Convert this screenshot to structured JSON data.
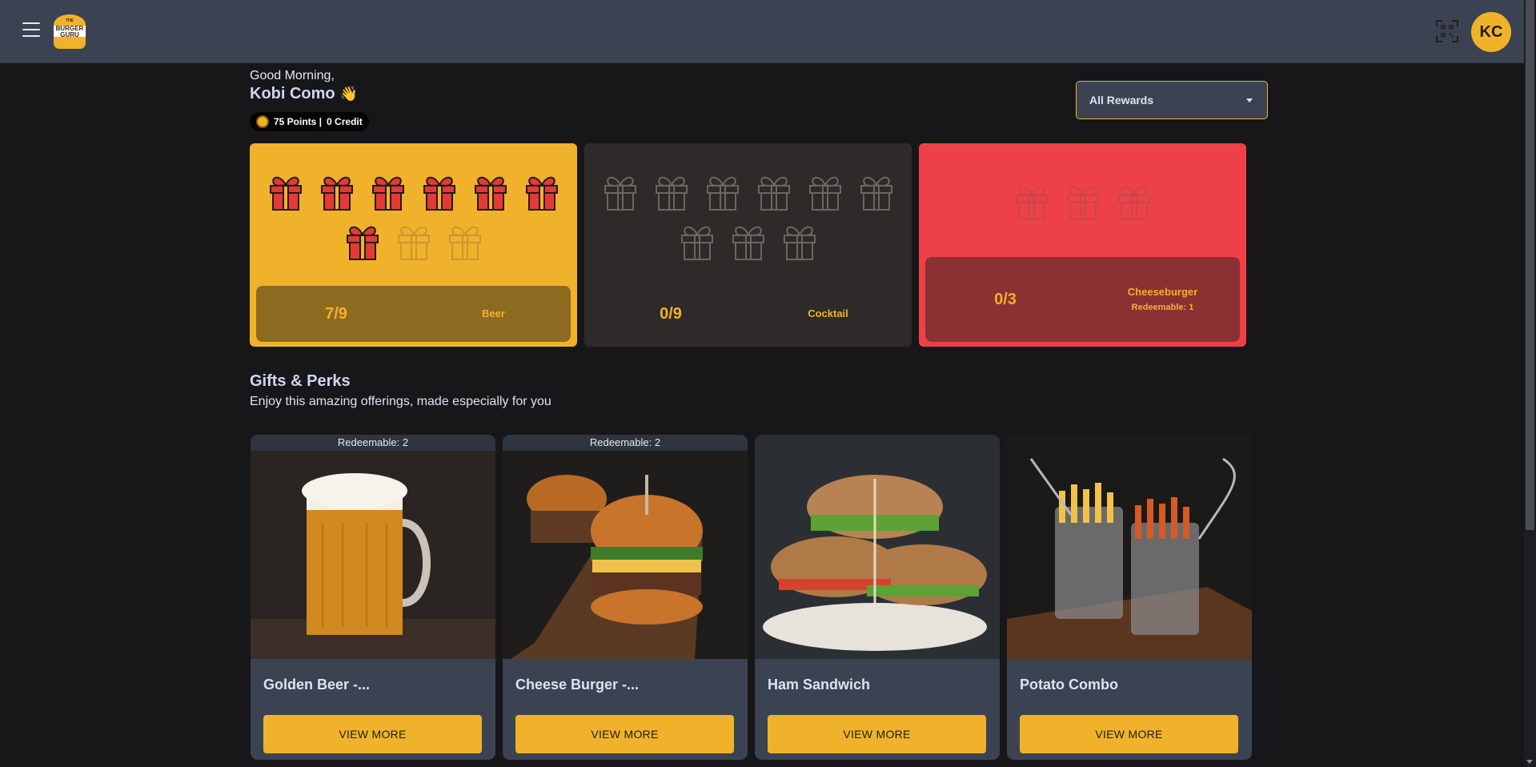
{
  "header": {
    "menu_icon": "hamburger-menu-icon",
    "logo_text_top": "THE",
    "logo_text_mid": "BURGER",
    "logo_text_bot": "GURU",
    "qr_icon": "qr-code-icon",
    "avatar_initials": "KC"
  },
  "user": {
    "greeting": "Good Morning,",
    "name": "Kobi Como",
    "wave": "👋",
    "points": "75 Points |",
    "credit": "0 Credit"
  },
  "filter": {
    "selected": "All Rewards"
  },
  "reward_cards": [
    {
      "count": "7/9",
      "name": "Beer",
      "redeemable": "",
      "total": 9,
      "earned": 7
    },
    {
      "count": "0/9",
      "name": "Cocktail",
      "redeemable": "",
      "total": 9,
      "earned": 0
    },
    {
      "count": "0/3",
      "name": "Cheeseburger",
      "redeemable": "Redeemable: 1",
      "total": 3,
      "earned": 0
    }
  ],
  "gifts_section": {
    "title": "Gifts & Perks",
    "subtitle": "Enjoy this amazing offerings, made especially for you"
  },
  "offers": [
    {
      "badge": "Redeemable: 2",
      "title": "Golden Beer -...",
      "button": "VIEW MORE"
    },
    {
      "badge": "Redeemable: 2",
      "title": "Cheese Burger -...",
      "button": "VIEW MORE"
    },
    {
      "badge": "",
      "title": "Ham Sandwich",
      "button": "VIEW MORE"
    },
    {
      "badge": "",
      "title": "Potato Combo",
      "button": "VIEW MORE"
    }
  ],
  "colors": {
    "accent": "#f0b22a",
    "topbar": "#3b4252",
    "background": "#17171a",
    "card_red": "#ee4147",
    "card_dark": "#2d2a29",
    "gift_red": "#e53935"
  }
}
